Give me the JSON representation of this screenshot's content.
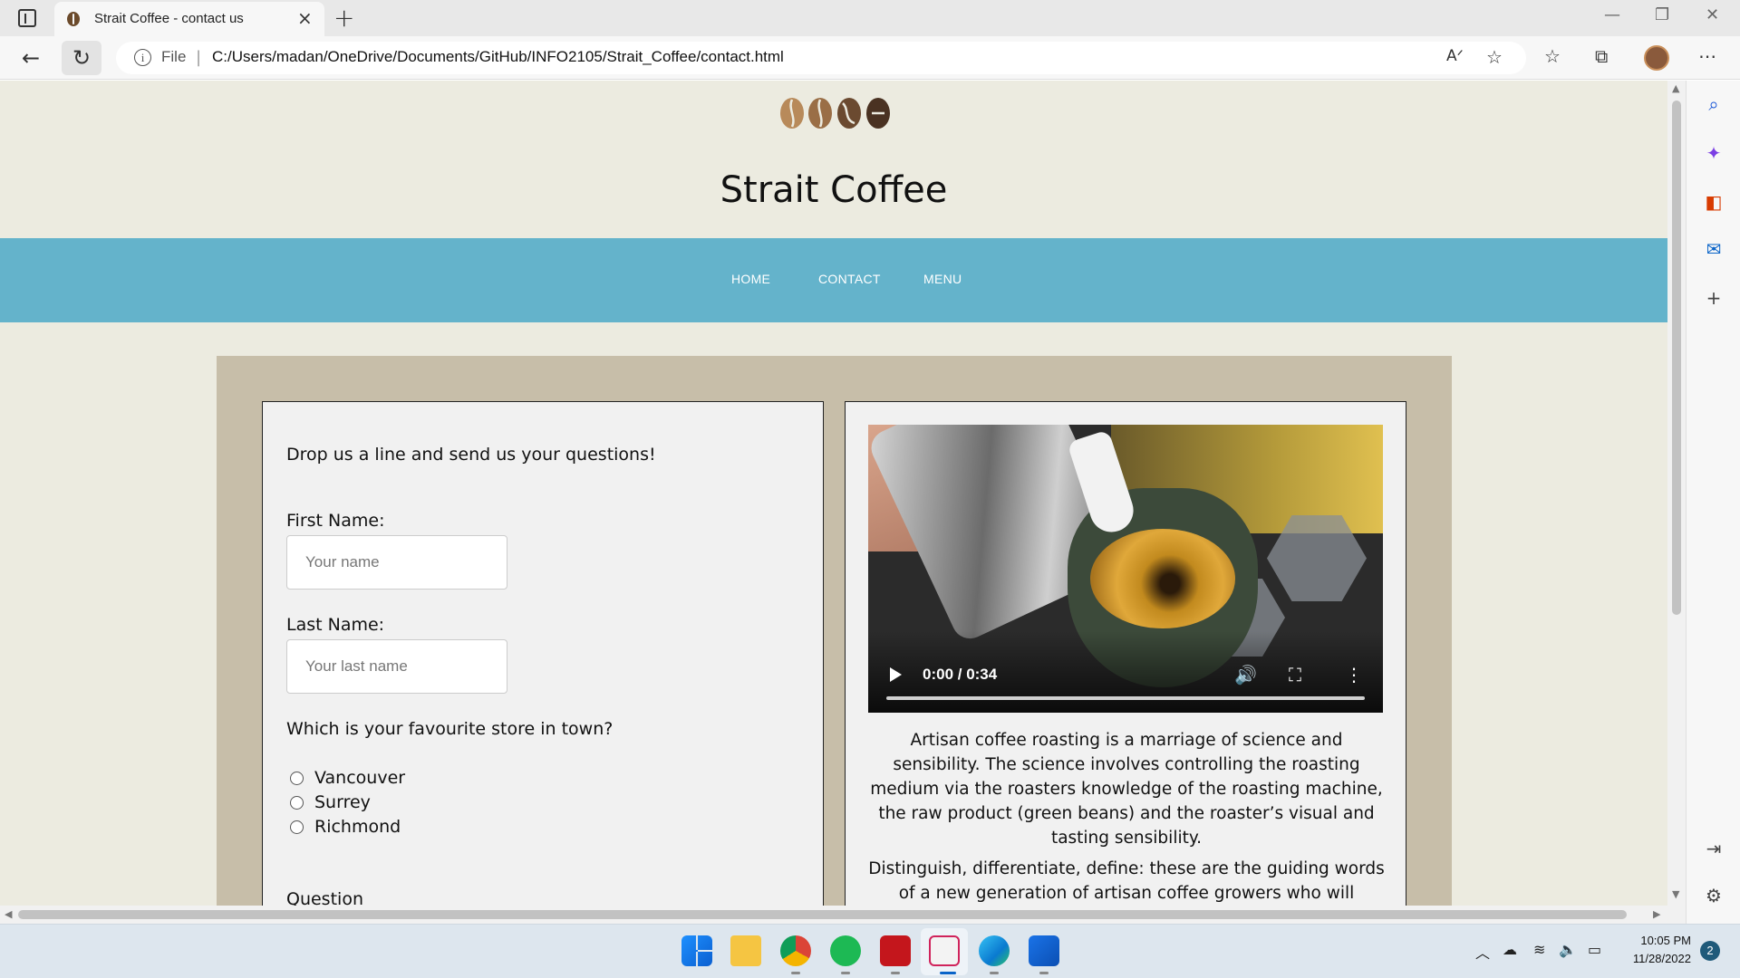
{
  "browser": {
    "tab_title": "Strait Coffee - contact us",
    "address_scheme": "File",
    "url": "C:/Users/madan/OneDrive/Documents/GitHub/INFO2105/Strait_Coffee/contact.html"
  },
  "site": {
    "title": "Strait Coffee",
    "nav": [
      "HOME",
      "CONTACT",
      "MENU"
    ]
  },
  "form": {
    "intro": "Drop us a line and send us your questions!",
    "first_name_label": "First Name:",
    "first_name_placeholder": "Your name",
    "last_name_label": "Last Name:",
    "last_name_placeholder": "Your last name",
    "store_question": "Which is your favourite store in town?",
    "stores": [
      "Vancouver",
      "Surrey",
      "Richmond"
    ],
    "question_label": "Question"
  },
  "video": {
    "time": "0:00 / 0:34",
    "progress": 0
  },
  "about": {
    "para1": "Artisan coffee roasting is a marriage of science and sensibility. The science involves controlling the roasting medium via the roasters knowledge of the roasting machine, the raw product (green beans) and the roaster’s visual and tasting sensibility.",
    "para2": "Distinguish, differentiate, define: these are the guiding words of a new generation of artisan coffee growers who will influence"
  },
  "taskbar": {
    "time": "10:05 PM",
    "date": "11/28/2022",
    "notifications": "2"
  },
  "colors": {
    "page_bg": "#ecebe0",
    "nav_band": "#64b3cb",
    "content_bg": "#c7bea9",
    "card_bg": "#f1f1f1"
  }
}
